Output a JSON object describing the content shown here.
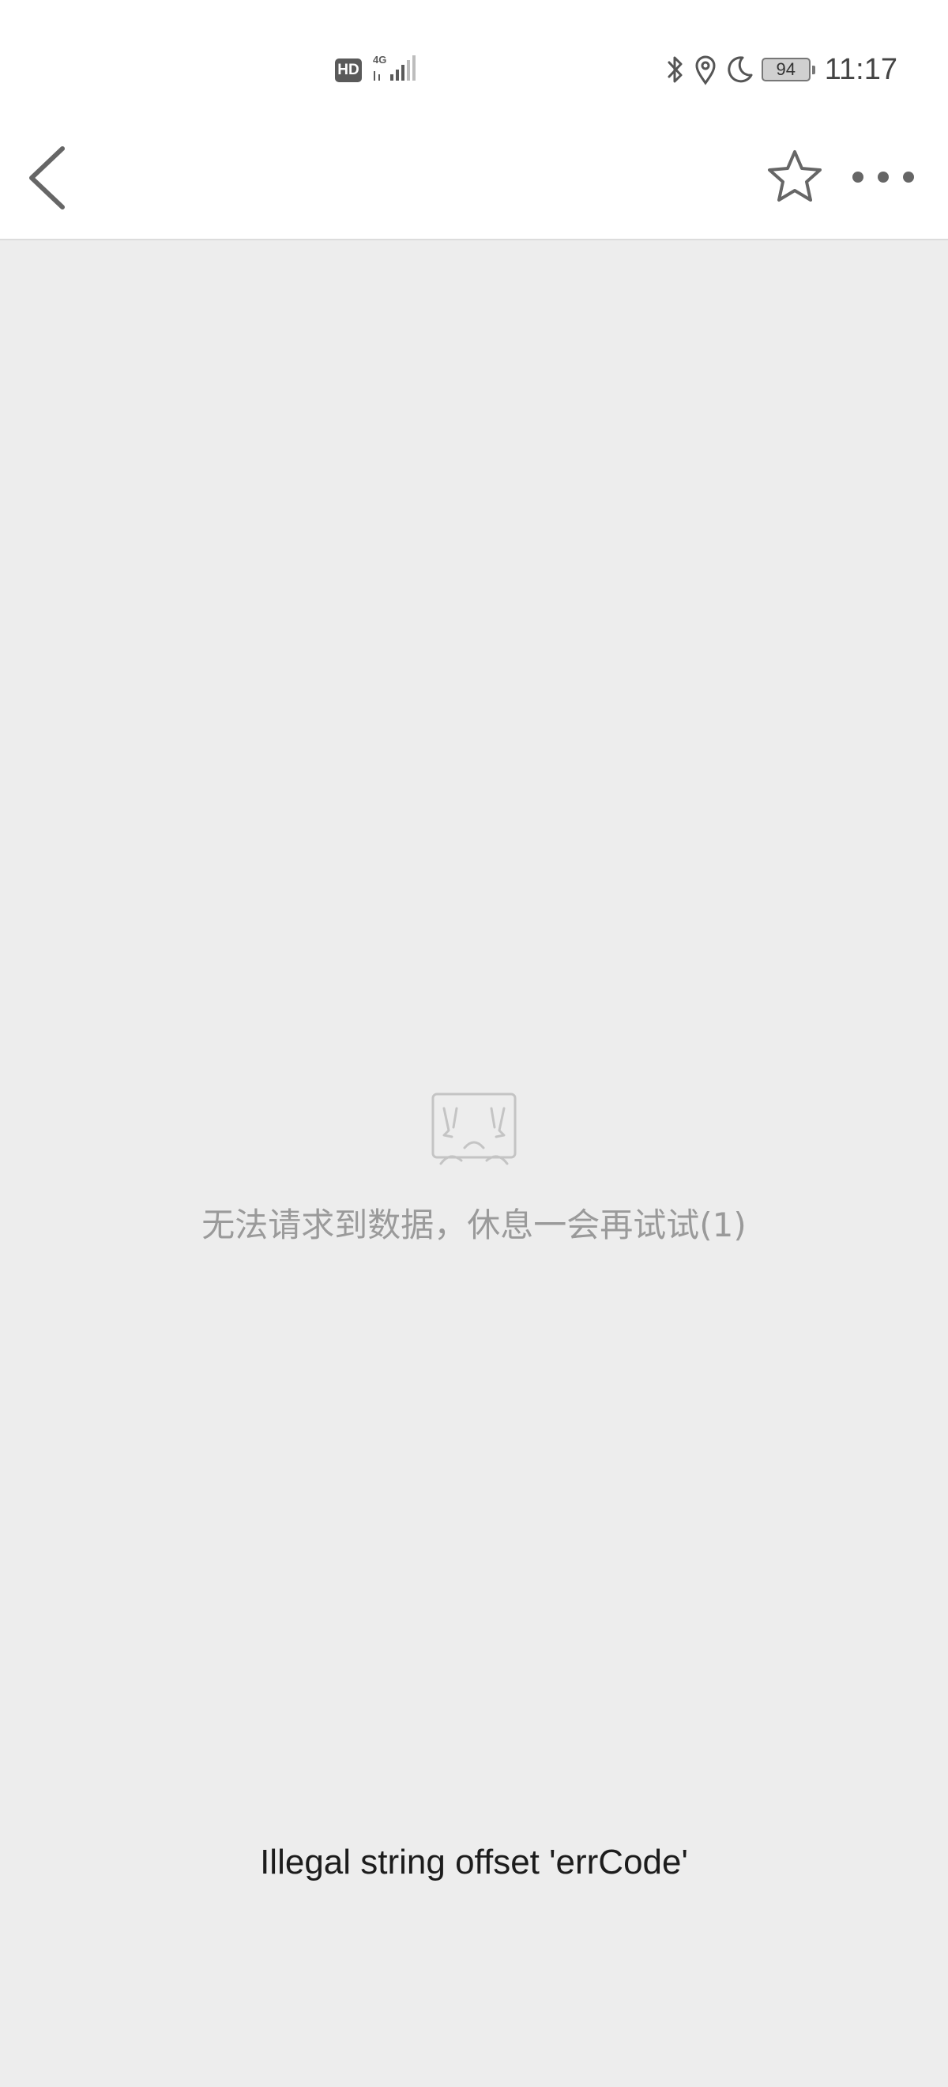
{
  "status_bar": {
    "hd_label": "HD",
    "network_label": "4G",
    "battery_level": "94",
    "time": "11:17",
    "icons": [
      "bluetooth-icon",
      "location-icon",
      "moon-icon",
      "battery-icon"
    ]
  },
  "nav_bar": {
    "icons": [
      "back-arrow-icon",
      "star-icon",
      "more-dots-icon"
    ]
  },
  "empty_state": {
    "icon": "crying-face-icon",
    "message": "无法请求到数据，休息一会再试试(1)"
  },
  "error": {
    "message": "Illegal string offset 'errCode'"
  },
  "colors": {
    "background": "#ededed",
    "bar_background": "#ffffff",
    "icon_gray": "#666666",
    "message_gray": "#9a9a9a",
    "error_text": "#1c1c1c"
  }
}
